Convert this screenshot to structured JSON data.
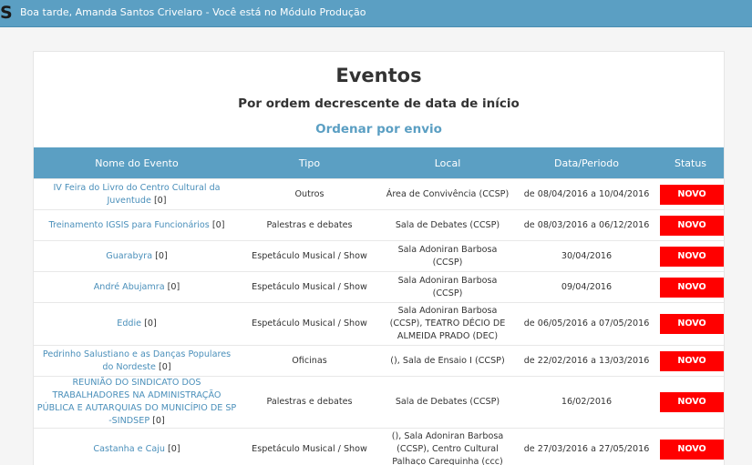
{
  "header": {
    "logo_fragment": "S",
    "greeting": "Boa tarde, Amanda Santos Crivelaro - Você está no Módulo Produção"
  },
  "main": {
    "title": "Eventos",
    "subtitle": "Por ordem decrescente de data de início",
    "order_link": "Ordenar por envio"
  },
  "table": {
    "columns": [
      "Nome do Evento",
      "Tipo",
      "Local",
      "Data/Periodo",
      "Status"
    ],
    "rows": [
      {
        "name": "IV Feira do Livro do Centro Cultural da Juventude",
        "count": "[0]",
        "tipo": "Outros",
        "local": "Área de Convivência (CCSP)",
        "data": "de 08/04/2016 a 10/04/2016",
        "status": "NOVO"
      },
      {
        "name": "Treinamento IGSIS para Funcionários",
        "count": "[0]",
        "tipo": "Palestras e debates",
        "local": "Sala de Debates (CCSP)",
        "data": "de 08/03/2016 a 06/12/2016",
        "status": "NOVO"
      },
      {
        "name": "Guarabyra",
        "count": "[0]",
        "tipo": "Espetáculo Musical / Show",
        "local": "Sala Adoniran Barbosa (CCSP)",
        "data": "30/04/2016",
        "status": "NOVO"
      },
      {
        "name": "André Abujamra",
        "count": "[0]",
        "tipo": "Espetáculo Musical / Show",
        "local": "Sala Adoniran Barbosa (CCSP)",
        "data": "09/04/2016",
        "status": "NOVO"
      },
      {
        "name": "Eddie",
        "count": "[0]",
        "tipo": "Espetáculo Musical / Show",
        "local": "Sala Adoniran Barbosa (CCSP), TEATRO DÉCIO DE ALMEIDA PRADO (DEC)",
        "data": "de 06/05/2016 a 07/05/2016",
        "status": "NOVO"
      },
      {
        "name": "Pedrinho Salustiano e as Danças Populares do Nordeste",
        "count": "[0]",
        "tipo": "Oficinas",
        "local": "(), Sala de Ensaio I (CCSP)",
        "data": "de 22/02/2016 a 13/03/2016",
        "status": "NOVO"
      },
      {
        "name": "REUNIÃO DO SINDICATO DOS TRABALHADORES NA ADMINISTRAÇÃO PÚBLICA E AUTARQUIAS DO MUNICÍPIO DE SP -SINDSEP",
        "count": "[0]",
        "tipo": "Palestras e debates",
        "local": "Sala de Debates (CCSP)",
        "data": "16/02/2016",
        "status": "NOVO"
      },
      {
        "name": "Castanha e Caju",
        "count": "[0]",
        "tipo": "Espetáculo Musical / Show",
        "local": "(), Sala Adoniran Barbosa (CCSP), Centro Cultural Palhaço Carequinha (ccc)",
        "data": "de 27/03/2016 a 27/05/2016",
        "status": "NOVO"
      }
    ]
  },
  "colors": {
    "header_bg": "#5b9fc3",
    "link": "#4a8fba",
    "status_new": "#ff0000"
  }
}
